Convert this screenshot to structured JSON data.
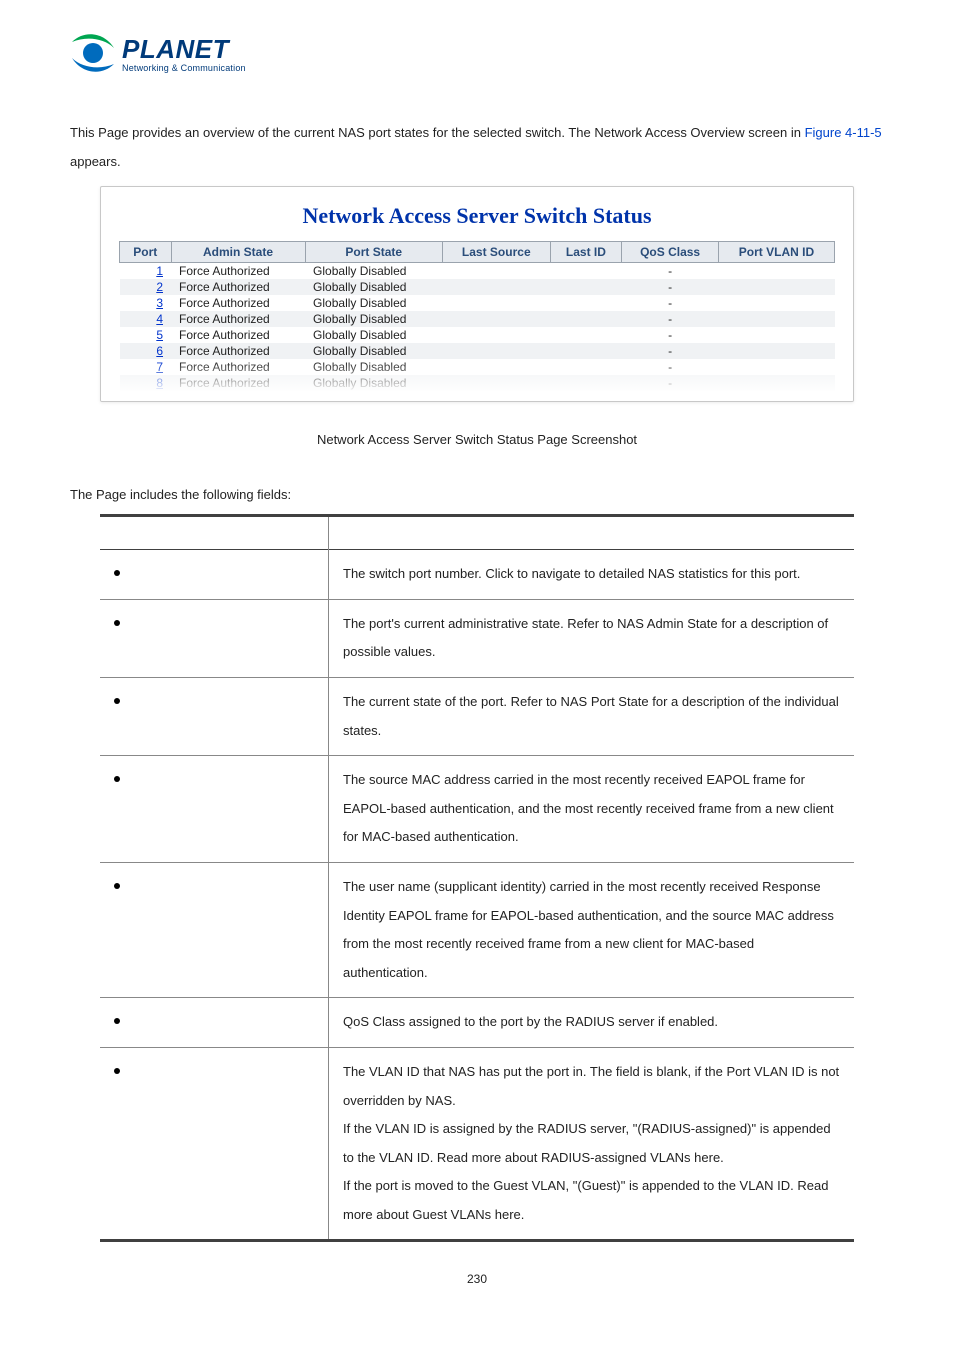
{
  "logo": {
    "name": "PLANET",
    "tagline": "Networking & Communication"
  },
  "intro": {
    "text_before": "This Page provides an overview of the current NAS port states for the selected switch. The Network Access Overview screen in ",
    "figref": "Figure 4-11-5",
    "text_after": " appears."
  },
  "screenshot": {
    "title": "Network Access Server Switch Status",
    "headers": [
      "Port",
      "Admin State",
      "Port State",
      "Last Source",
      "Last ID",
      "QoS Class",
      "Port VLAN ID"
    ],
    "rows": [
      {
        "port": "1",
        "admin": "Force Authorized",
        "pstate": "Globally Disabled",
        "ls": "",
        "li": "",
        "qos": "-",
        "pv": ""
      },
      {
        "port": "2",
        "admin": "Force Authorized",
        "pstate": "Globally Disabled",
        "ls": "",
        "li": "",
        "qos": "-",
        "pv": ""
      },
      {
        "port": "3",
        "admin": "Force Authorized",
        "pstate": "Globally Disabled",
        "ls": "",
        "li": "",
        "qos": "-",
        "pv": ""
      },
      {
        "port": "4",
        "admin": "Force Authorized",
        "pstate": "Globally Disabled",
        "ls": "",
        "li": "",
        "qos": "-",
        "pv": ""
      },
      {
        "port": "5",
        "admin": "Force Authorized",
        "pstate": "Globally Disabled",
        "ls": "",
        "li": "",
        "qos": "-",
        "pv": ""
      },
      {
        "port": "6",
        "admin": "Force Authorized",
        "pstate": "Globally Disabled",
        "ls": "",
        "li": "",
        "qos": "-",
        "pv": ""
      },
      {
        "port": "7",
        "admin": "Force Authorized",
        "pstate": "Globally Disabled",
        "ls": "",
        "li": "",
        "qos": "-",
        "pv": ""
      },
      {
        "port": "8",
        "admin": "Force Authorized",
        "pstate": "Globally Disabled",
        "ls": "",
        "li": "",
        "qos": "-",
        "pv": ""
      }
    ]
  },
  "caption": "Network Access Server Switch Status Page Screenshot",
  "section_heading": "The Page includes the following fields:",
  "fields": [
    {
      "desc": "The switch port number. Click to navigate to detailed NAS statistics for this port."
    },
    {
      "desc": "The port's current administrative state. Refer to NAS Admin State for a description of possible values."
    },
    {
      "desc": "The current state of the port. Refer to NAS Port State for a description of the individual states."
    },
    {
      "desc": "The source MAC address carried in the most recently received EAPOL frame for EAPOL-based authentication, and the most recently received frame from a new client for MAC-based authentication."
    },
    {
      "desc": "The user name (supplicant identity) carried in the most recently received Response Identity EAPOL frame for EAPOL-based authentication, and the source MAC address from the most recently received frame from a new client for MAC-based authentication."
    },
    {
      "desc": "QoS Class assigned to the port by the RADIUS server if enabled."
    },
    {
      "desc": "The VLAN ID that NAS has put the port in. The field is blank, if the Port VLAN ID is not overridden by NAS.\nIf the VLAN ID is assigned by the RADIUS server, \"(RADIUS-assigned)\" is appended to the VLAN ID. Read more about RADIUS-assigned VLANs here.\nIf the port is moved to the Guest VLAN, \"(Guest)\" is appended to the VLAN ID. Read more about Guest VLANs here."
    }
  ],
  "page_number": "230"
}
